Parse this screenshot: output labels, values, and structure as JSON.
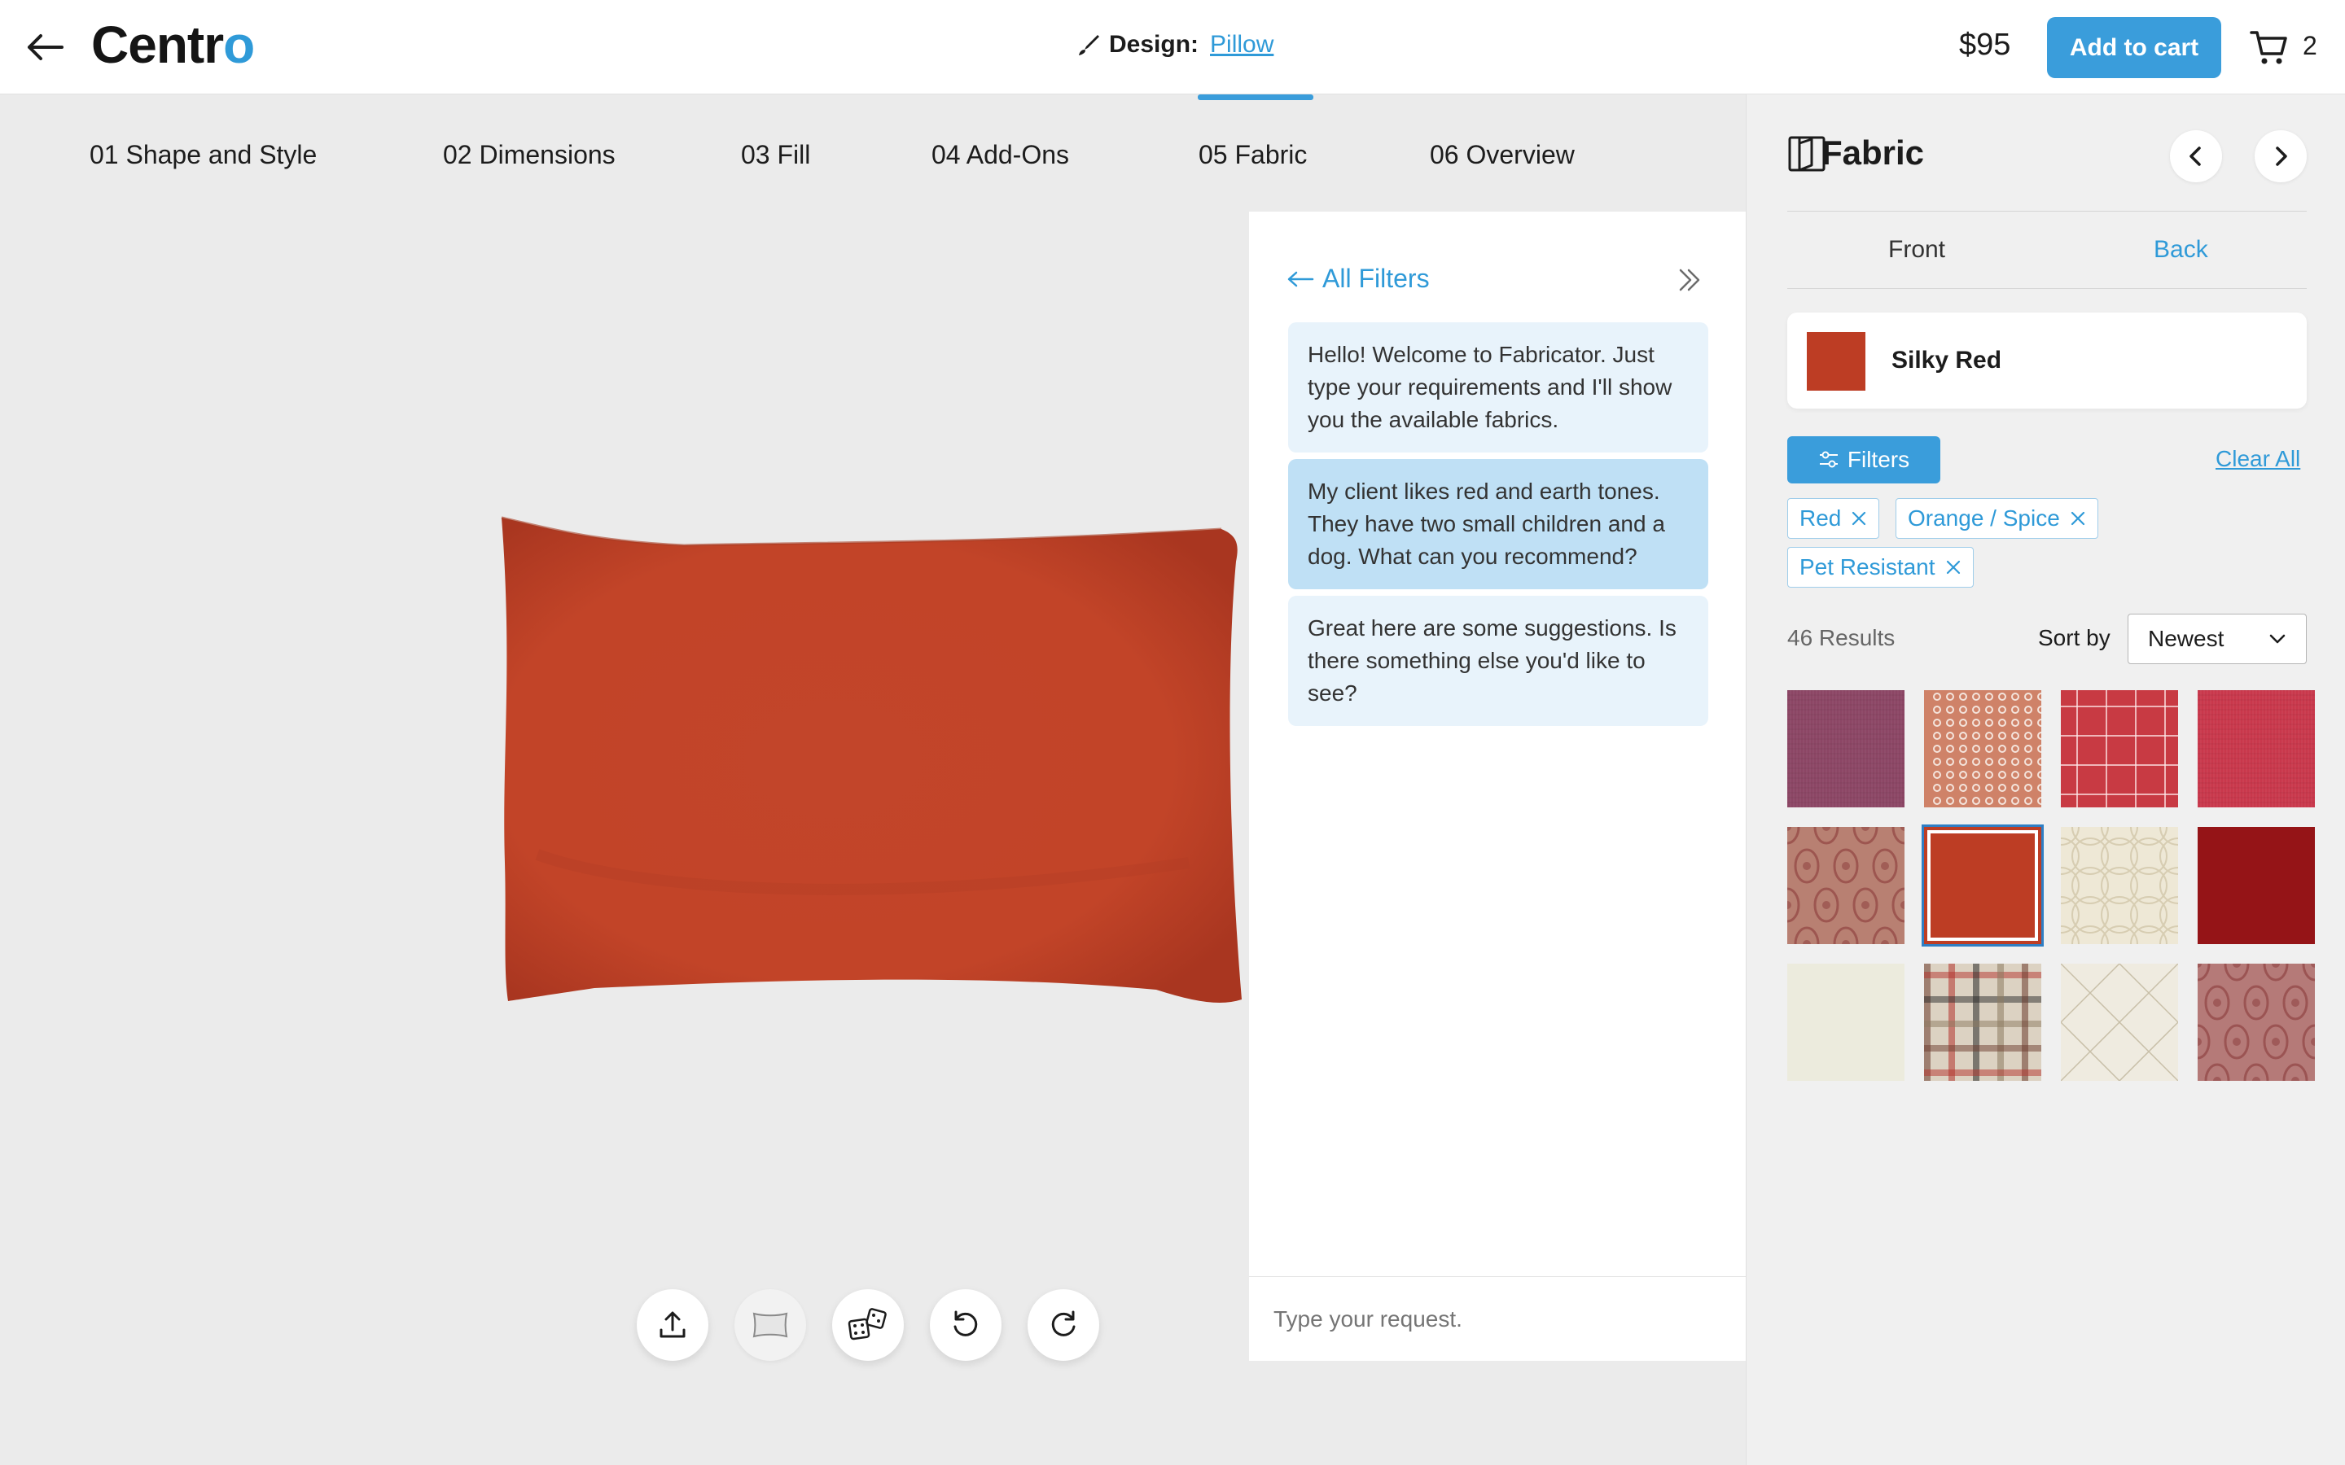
{
  "header": {
    "logo_main": "Centr",
    "logo_accent": "o",
    "design_label": "Design:",
    "design_link": "Pillow",
    "price": "$95",
    "add_to_cart": "Add to cart",
    "cart_count": "2"
  },
  "steps": [
    {
      "label": "01 Shape and Style"
    },
    {
      "label": "02 Dimensions"
    },
    {
      "label": "03 Fill"
    },
    {
      "label": "04 Add-Ons"
    },
    {
      "label": "05 Fabric",
      "active": true
    },
    {
      "label": "06 Overview"
    }
  ],
  "chat": {
    "all_filters": "All Filters",
    "messages": [
      {
        "role": "assistant",
        "text": "Hello! Welcome to Fabricator. Just type your requirements and I'll show you the available fabrics."
      },
      {
        "role": "user",
        "text": "My client likes red and earth tones. They have two small children and a dog. What can you recommend?"
      },
      {
        "role": "assistant",
        "text": "Great here are some suggestions. Is there something else you'd like to see?"
      }
    ],
    "input_placeholder": "Type your request."
  },
  "panel": {
    "title": "Fabric",
    "tabs": [
      "Front",
      "Back"
    ],
    "active_tab": "Back",
    "selected_fabric": "Silky Red",
    "filters_label": "Filters",
    "clear_all": "Clear All",
    "chips": [
      "Red",
      "Orange / Spice",
      "Pet Resistant"
    ],
    "results": "46 Results",
    "sort_by": "Sort by",
    "sort_value": "Newest"
  },
  "colors": {
    "accent": "#3a9ddb",
    "pillow": "#c4462a",
    "selected_swatch": "#bd3d24"
  },
  "swatches": [
    {
      "name": "purple-tweed-swatch",
      "color": "#8c4665",
      "pattern": "tweed"
    },
    {
      "name": "rust-geometric-swatch",
      "color": "#cf8268",
      "pattern": "dots"
    },
    {
      "name": "red-plaid-swatch",
      "color": "#c83a43",
      "pattern": "plaid"
    },
    {
      "name": "red-texture-swatch",
      "color": "#c9384c",
      "pattern": "tweed"
    },
    {
      "name": "red-damask-swatch",
      "color": "#b88072",
      "pattern": "damask"
    },
    {
      "name": "silky-red-swatch",
      "color": "#bd3d24",
      "pattern": "solid",
      "selected": true
    },
    {
      "name": "cream-circle-swatch",
      "color": "#eee8d6",
      "pattern": "rings"
    },
    {
      "name": "dark-red-swatch",
      "color": "#951417",
      "pattern": "solid"
    },
    {
      "name": "ivory-swatch",
      "color": "#ecebdd",
      "pattern": "solid"
    },
    {
      "name": "houndstooth-plaid-swatch",
      "color": "#dcd2c2",
      "pattern": "tartan"
    },
    {
      "name": "ivory-diamond-swatch",
      "color": "#efebe0",
      "pattern": "lines"
    },
    {
      "name": "rose-damask-swatch",
      "color": "#b57a78",
      "pattern": "damask"
    }
  ]
}
